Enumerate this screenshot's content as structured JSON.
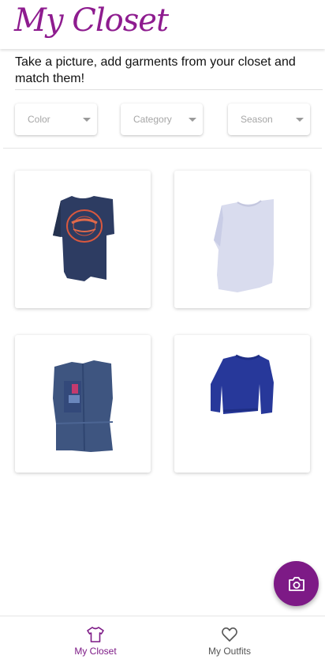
{
  "app": {
    "title": "My Closet",
    "accent_color": "#7d1a86",
    "instructions": "Take a picture, add garments from your closet and match them!"
  },
  "filters": [
    {
      "id": "color",
      "placeholder": "Color"
    },
    {
      "id": "category",
      "placeholder": "Category"
    },
    {
      "id": "season",
      "placeholder": "Season"
    }
  ],
  "garments": [
    {
      "type": "t-shirt",
      "color": "#2d3c62",
      "print_color": "#d9583e"
    },
    {
      "type": "t-shirt",
      "color": "#d9dcee"
    },
    {
      "type": "denim shirt",
      "color": "#3e5580"
    },
    {
      "type": "sweater",
      "color": "#27389a"
    }
  ],
  "fab": {
    "icon": "camera-icon"
  },
  "bottom_nav": {
    "items": [
      {
        "label": "My Closet",
        "icon": "tshirt-icon",
        "active": true
      },
      {
        "label": "My Outfits",
        "icon": "heart-icon",
        "active": false
      }
    ]
  }
}
